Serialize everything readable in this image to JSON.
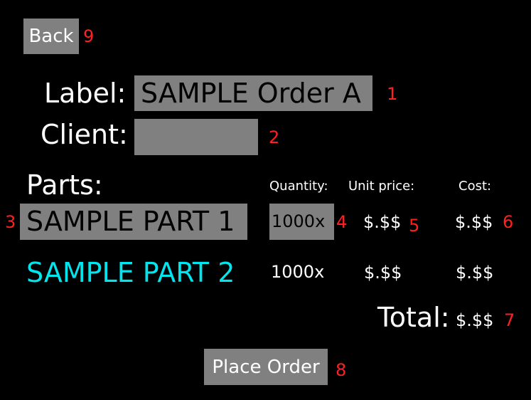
{
  "back_button": {
    "label": "Back",
    "marker": "9"
  },
  "label_field": {
    "caption": "Label:",
    "value": "SAMPLE Order A",
    "marker": "1"
  },
  "client_field": {
    "caption": "Client:",
    "value": "",
    "marker": "2"
  },
  "parts": {
    "heading": "Parts:",
    "columns": {
      "quantity": "Quantity:",
      "unit_price": "Unit price:",
      "cost": "Cost:"
    },
    "rows": [
      {
        "name": "SAMPLE PART 1",
        "quantity": "1000x",
        "unit_price": "$.$$",
        "cost": "$.$$",
        "name_marker": "3",
        "quantity_marker": "4",
        "unit_price_marker": "5",
        "cost_marker": "6"
      },
      {
        "name": "SAMPLE PART 2",
        "quantity": "1000x",
        "unit_price": "$.$$",
        "cost": "$.$$"
      }
    ]
  },
  "total": {
    "caption": "Total:",
    "value": "$.$$",
    "marker": "7"
  },
  "place_order_button": {
    "label": "Place Order",
    "marker": "8"
  },
  "colors": {
    "background": "#000000",
    "field": "#808080",
    "marker": "#ff2020",
    "highlight_part": "#00e5ee"
  }
}
